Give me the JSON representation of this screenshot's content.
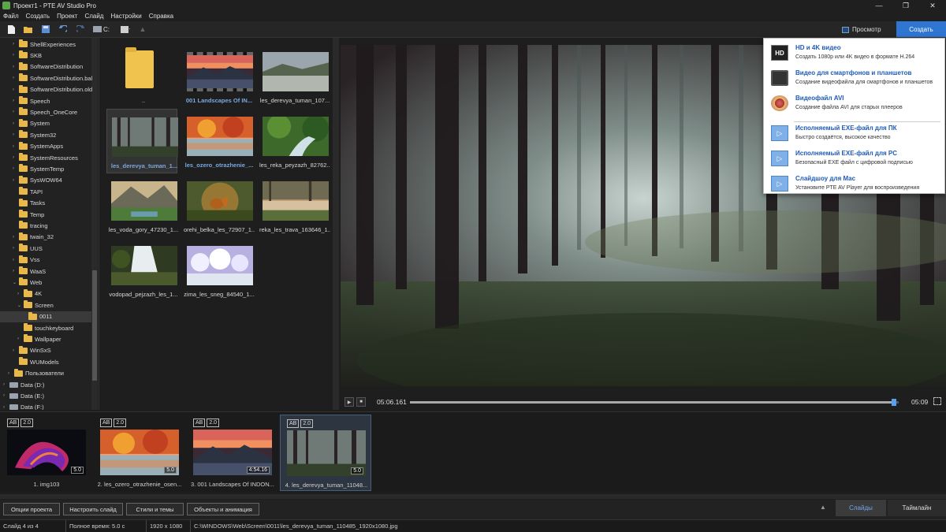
{
  "window": {
    "title": "Проект1 - PTE AV Studio Pro",
    "minimize": "—",
    "maximize": "❐",
    "close": "✕"
  },
  "menu": [
    "Файл",
    "Создать",
    "Проект",
    "Слайд",
    "Настройки",
    "Справка"
  ],
  "toolbar": {
    "drive_label": "C:",
    "preview_label": "Просмотр",
    "create_label": "Создать"
  },
  "tree": [
    {
      "label": "ShellExperiences",
      "indent": 1,
      "expand": "›"
    },
    {
      "label": "SKB",
      "indent": 1,
      "expand": "›"
    },
    {
      "label": "SoftwareDistribution",
      "indent": 1,
      "expand": "›"
    },
    {
      "label": "SoftwareDistribution.bal",
      "indent": 1,
      "expand": "›"
    },
    {
      "label": "SoftwareDistribution.old",
      "indent": 1,
      "expand": "›"
    },
    {
      "label": "Speech",
      "indent": 1,
      "expand": "›"
    },
    {
      "label": "Speech_OneCore",
      "indent": 1,
      "expand": "›"
    },
    {
      "label": "System",
      "indent": 1,
      "expand": "›"
    },
    {
      "label": "System32",
      "indent": 1,
      "expand": "›"
    },
    {
      "label": "SystemApps",
      "indent": 1,
      "expand": "›"
    },
    {
      "label": "SystemResources",
      "indent": 1,
      "expand": "›"
    },
    {
      "label": "SystemTemp",
      "indent": 1,
      "expand": "›"
    },
    {
      "label": "SysWOW64",
      "indent": 1,
      "expand": "›"
    },
    {
      "label": "TAPI",
      "indent": 1,
      "expand": ""
    },
    {
      "label": "Tasks",
      "indent": 1,
      "expand": ""
    },
    {
      "label": "Temp",
      "indent": 1,
      "expand": ""
    },
    {
      "label": "tracing",
      "indent": 1,
      "expand": ""
    },
    {
      "label": "twain_32",
      "indent": 1,
      "expand": "›"
    },
    {
      "label": "UUS",
      "indent": 1,
      "expand": "›"
    },
    {
      "label": "Vss",
      "indent": 1,
      "expand": "›"
    },
    {
      "label": "WaaS",
      "indent": 1,
      "expand": "›"
    },
    {
      "label": "Web",
      "indent": 1,
      "expand": "⌄"
    },
    {
      "label": "4K",
      "indent": 2,
      "expand": "›"
    },
    {
      "label": "Screen",
      "indent": 2,
      "expand": "⌄"
    },
    {
      "label": "0011",
      "indent": 3,
      "expand": "",
      "selected": true
    },
    {
      "label": "touchkeyboard",
      "indent": 2,
      "expand": ""
    },
    {
      "label": "Wallpaper",
      "indent": 2,
      "expand": "›"
    },
    {
      "label": "WinSxS",
      "indent": 1,
      "expand": "›"
    },
    {
      "label": "WUModels",
      "indent": 1,
      "expand": ""
    },
    {
      "label": "Пользователи",
      "indent": 0,
      "expand": "›"
    },
    {
      "label": "Data (D:)",
      "indent": -1,
      "expand": "›",
      "drive": true
    },
    {
      "label": "Data (E:)",
      "indent": -1,
      "expand": "›",
      "drive": true
    },
    {
      "label": "Data (F:)",
      "indent": -1,
      "expand": "›",
      "drive": true
    }
  ],
  "files": [
    {
      "name": "..",
      "type": "folder"
    },
    {
      "name": "001 Landscapes Of IN...",
      "type": "film",
      "used": true,
      "art": "mountains-dusk"
    },
    {
      "name": "les_derevya_tuman_107...",
      "type": "image",
      "art": "fog-hills"
    },
    {
      "name": "les_derevya_tuman_1...",
      "type": "image",
      "used": true,
      "selected": true,
      "art": "forest-fog"
    },
    {
      "name": "les_ozero_otrazhenie_...",
      "type": "image",
      "used": true,
      "art": "autumn-lake"
    },
    {
      "name": "les_reka_peyzazh_82762...",
      "type": "image",
      "art": "green-river"
    },
    {
      "name": "les_voda_gory_47230_1...",
      "type": "image",
      "art": "mountain-lake"
    },
    {
      "name": "orehi_belka_les_72907_1...",
      "type": "image",
      "art": "squirrel"
    },
    {
      "name": "reka_les_trava_163646_1...",
      "type": "image",
      "art": "river-grass"
    },
    {
      "name": "vodopad_pejzazh_les_1...",
      "type": "image",
      "art": "waterfall"
    },
    {
      "name": "zima_les_sneg_84540_1...",
      "type": "image",
      "art": "winter"
    }
  ],
  "transport": {
    "play": "▶",
    "stop": "■",
    "current_time": "05:06.161",
    "duration": "05:09",
    "progress": 0.99
  },
  "create_menu": [
    {
      "title": "HD и 4K видео",
      "subtitle": "Создать 1080p или 4K видео в формате H.264",
      "icon": "hd-icon",
      "icon_text": "HD"
    },
    {
      "title": "Видео для смартфонов и планшетов",
      "subtitle": "Создание видеофайла для смартфонов и планшетов",
      "icon": "phone-icon",
      "icon_text": ""
    },
    {
      "title": "Видеофайл AVI",
      "subtitle": "Создание файла AVI для старых плееров",
      "icon": "avi-icon",
      "icon_text": ""
    },
    {
      "title": "Исполняемый EXE-файл для ПК",
      "subtitle": "Быстро создаётся, высокое качество",
      "icon": "exe-icon",
      "icon_text": "▷"
    },
    {
      "title": "Исполняемый EXE-файл для PC",
      "subtitle": "Безопасный EXE файл с цифровой подписью",
      "icon": "exe-signed-icon",
      "icon_text": "▷"
    },
    {
      "title": "Слайдшоу для Mac",
      "subtitle": "Установите PTE AV Player для воспроизведения",
      "icon": "mac-icon",
      "icon_text": "▷"
    }
  ],
  "slides": [
    {
      "name": "1. img103",
      "duration": "5.0",
      "ab": "AB",
      "speed": "2.0",
      "art": "abstract"
    },
    {
      "name": "2. les_ozero_otrazhenie_osen...",
      "duration": "5.0",
      "ab": "AB",
      "speed": "2.0",
      "art": "autumn-lake"
    },
    {
      "name": "3. 001 Landscapes Of INDON...",
      "duration": "4:54.16",
      "ab": "AB",
      "speed": "2.0",
      "art": "mountains-dusk"
    },
    {
      "name": "4. les_derevya_tuman_11048...",
      "duration": "5.0",
      "ab": "AB",
      "speed": "2.0",
      "art": "forest-fog",
      "selected": true
    }
  ],
  "bottom_buttons": [
    "Опции проекта",
    "Настроить слайд",
    "Стили и темы",
    "Объекты и анимация"
  ],
  "tabs": {
    "slides": "Слайды",
    "timeline": "Таймлайн",
    "arrow": "▲"
  },
  "status": {
    "slide": "Слайд 4 из 4",
    "total_time": "Полное время: 5.0 с",
    "resolution": "1920 x 1080",
    "path": "C:\\WINDOWS\\Web\\Screen\\0011\\les_derevya_tuman_110485_1920x1080.jpg"
  }
}
